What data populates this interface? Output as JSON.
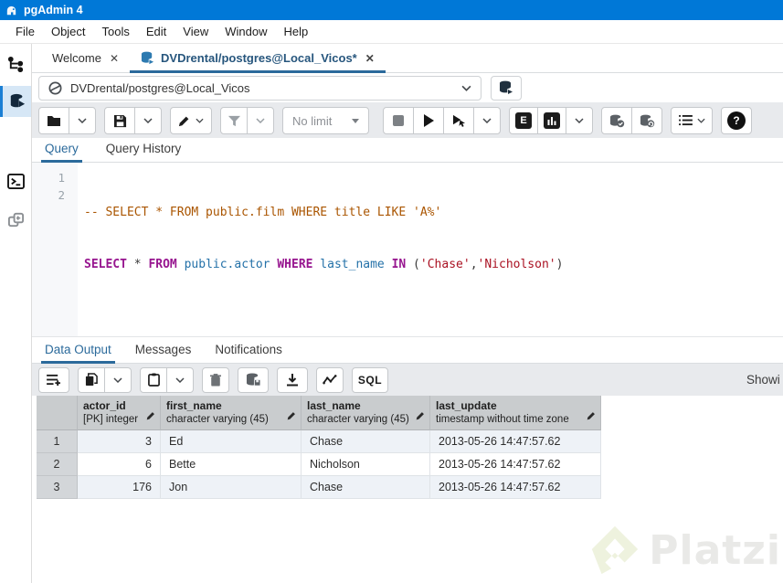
{
  "colors": {
    "titlebar_blue": "#0078d7",
    "accent_blue": "#2b6a9b",
    "sidebar_active_blue": "#1b7fd4",
    "toolbar_gray": "#e8eaed",
    "table_header_gray": "#c9ccce",
    "row_stripe_blue": "#eef2f7",
    "sql_keyword": "#97158f",
    "sql_comment": "#aa5500",
    "sql_string": "#aa1122",
    "sql_identifier": "#2471a8",
    "platzi_green": "#edf2de"
  },
  "titlebar": {
    "title": "pgAdmin 4"
  },
  "menubar": {
    "items": [
      "File",
      "Object",
      "Tools",
      "Edit",
      "View",
      "Window",
      "Help"
    ]
  },
  "main_tabs": {
    "welcome_label": "Welcome",
    "welcome_close": "✕",
    "query_label": "DVDrental/postgres@Local_Vicos*",
    "query_close": "✕"
  },
  "connection": {
    "value": "DVDrental/postgres@Local_Vicos"
  },
  "toolbar": {
    "limit_label": "No limit",
    "explain_label": "E",
    "help_glyph": "?"
  },
  "editor_tabs": {
    "query": "Query",
    "history": "Query History"
  },
  "editor": {
    "line1_num": "1",
    "line2_num": "2",
    "line1_comment": "-- SELECT * FROM public.film WHERE title LIKE 'A%'",
    "line2": {
      "kw1": "SELECT",
      "pl1": " * ",
      "kw2": "FROM",
      "id1": " public.actor ",
      "kw3": "WHERE",
      "id2": " last_name ",
      "kw4": "IN",
      "pl2": " (",
      "s1": "'Chase'",
      "pl3": ",",
      "s2": "'Nicholson'",
      "pl4": ")"
    }
  },
  "output": {
    "tabs": {
      "data": "Data Output",
      "messages": "Messages",
      "notifications": "Notifications"
    },
    "sql_button": "SQL",
    "showing_clipped": "Showi"
  },
  "table": {
    "columns": [
      {
        "name": "actor_id",
        "type": "[PK] integer"
      },
      {
        "name": "first_name",
        "type": "character varying (45)"
      },
      {
        "name": "last_name",
        "type": "character varying (45)"
      },
      {
        "name": "last_update",
        "type": "timestamp without time zone"
      }
    ],
    "rows": [
      {
        "n": "1",
        "actor_id": "3",
        "first_name": "Ed",
        "last_name": "Chase",
        "last_update": "2013-05-26 14:47:57.62"
      },
      {
        "n": "2",
        "actor_id": "6",
        "first_name": "Bette",
        "last_name": "Nicholson",
        "last_update": "2013-05-26 14:47:57.62"
      },
      {
        "n": "3",
        "actor_id": "176",
        "first_name": "Jon",
        "last_name": "Chase",
        "last_update": "2013-05-26 14:47:57.62"
      }
    ]
  },
  "watermark": {
    "text": "Platzi"
  }
}
